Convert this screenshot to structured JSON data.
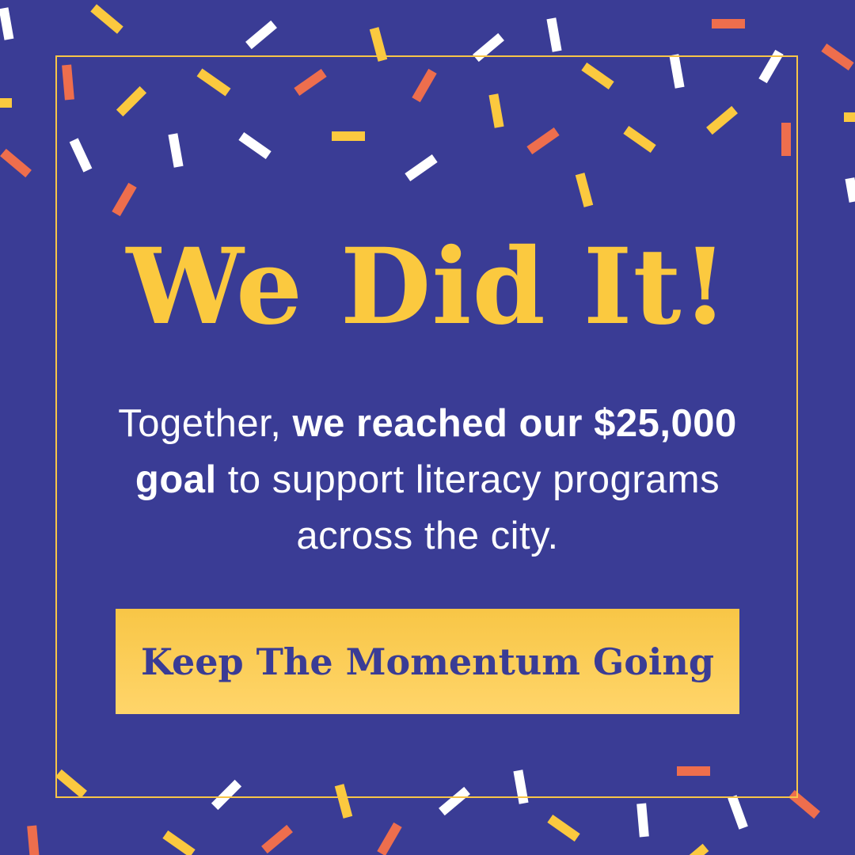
{
  "colors": {
    "background": "#3a3c95",
    "accent_yellow": "#fbc93f",
    "confetti_white": "#ffffff",
    "confetti_orange": "#ee6e4d",
    "confetti_yellow": "#fbc93f",
    "button_text": "#3a3c95"
  },
  "headline": "We Did It!",
  "message": {
    "part1": "Together, ",
    "bold1": "we reached our $25,000 goal",
    "part2": " to support literacy programs across the city."
  },
  "cta_label": "Keep The Momentum Going"
}
